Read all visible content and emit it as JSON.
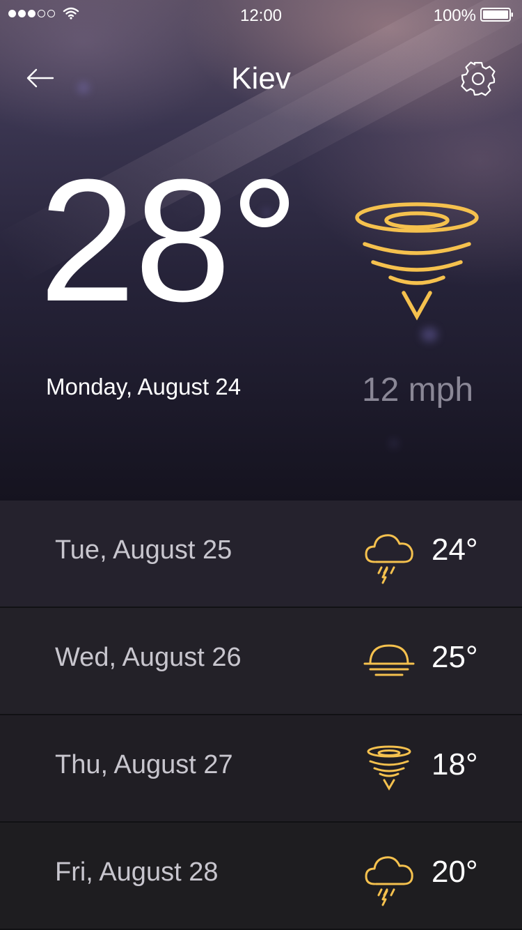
{
  "status_bar": {
    "time": "12:00",
    "battery": "100%"
  },
  "header": {
    "city": "Kiev"
  },
  "current": {
    "temperature": "28°",
    "date": "Monday, August 24",
    "wind_speed": "12 mph",
    "condition_icon": "tornado-icon"
  },
  "forecast": [
    {
      "day": "Tue, August 25",
      "temp": "24°",
      "icon": "thunderstorm-icon"
    },
    {
      "day": "Wed, August 26",
      "temp": "25°",
      "icon": "sunset-icon"
    },
    {
      "day": "Thu, August 27",
      "temp": "18°",
      "icon": "tornado-icon"
    },
    {
      "day": "Fri, August 28",
      "temp": "20°",
      "icon": "thunderstorm-icon"
    }
  ],
  "colors": {
    "accent": "#f5c14e",
    "muted": "#8a8796",
    "row_text": "#c8c6ce"
  }
}
